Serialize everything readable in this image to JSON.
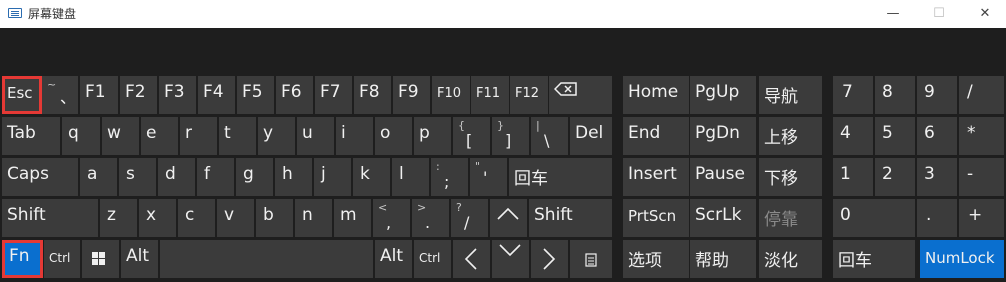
{
  "window": {
    "title": "屏幕键盘",
    "minimize": "—",
    "maximize": "☐",
    "close": "✕"
  },
  "keys": {
    "esc": "Esc",
    "tilde": "~",
    "backtick": "、",
    "f1": "F1",
    "f2": "F2",
    "f3": "F3",
    "f4": "F4",
    "f5": "F5",
    "f6": "F6",
    "f7": "F7",
    "f8": "F8",
    "f9": "F9",
    "f10": "F10",
    "f11": "F11",
    "f12": "F12",
    "home": "Home",
    "pgup": "PgUp",
    "nav": "导航",
    "tab": "Tab",
    "q": "q",
    "w": "w",
    "e": "e",
    "r": "r",
    "t": "t",
    "y": "y",
    "u": "u",
    "i": "i",
    "o": "o",
    "p": "p",
    "lbrace": "{",
    "lbracket": "[",
    "rbrace": "}",
    "rbracket": "]",
    "pipe": "|",
    "backslash": "\\",
    "del": "Del",
    "end": "End",
    "pgdn": "PgDn",
    "moveup": "上移",
    "caps": "Caps",
    "a": "a",
    "s": "s",
    "d": "d",
    "f": "f",
    "g": "g",
    "h": "h",
    "j": "j",
    "k": "k",
    "l": "l",
    "colon": ":",
    "semicolon": ";",
    "quote": "\"",
    "apostrophe": "'",
    "enter": "回车",
    "insert": "Insert",
    "pause": "Pause",
    "movedown": "下移",
    "shift": "Shift",
    "z": "z",
    "x": "x",
    "c": "c",
    "v": "v",
    "b": "b",
    "n": "n",
    "m": "m",
    "lt": "<",
    "comma": ",",
    "gt": ">",
    "period": ".",
    "question": "?",
    "slash": "/",
    "prtscn": "PrtScn",
    "scrlk": "ScrLk",
    "dock": "停靠",
    "fn": "Fn",
    "ctrl": "Ctrl",
    "alt": "Alt",
    "options": "选项",
    "help": "帮助",
    "fade": "淡化",
    "num7": "7",
    "num8": "8",
    "num9": "9",
    "numdiv": "/",
    "num4": "4",
    "num5": "5",
    "num6": "6",
    "nummul": "*",
    "num1": "1",
    "num2": "2",
    "num3": "3",
    "numsub": "-",
    "num0": "0",
    "numdot": ".",
    "numadd": "+",
    "numenter": "回车",
    "numlock": "NumLock"
  },
  "highlighted_keys": [
    "Esc",
    "Fn"
  ],
  "active_keys": [
    "Fn",
    "NumLock"
  ],
  "colors": {
    "background": "#1e1e1e",
    "key": "#3b3b3b",
    "active": "#0a6fcf",
    "highlight": "#e53935",
    "titlebar": "#ffffff"
  },
  "icons": {
    "backspace": "backspace-icon",
    "windows": "windows-logo-icon",
    "menu": "context-menu-icon",
    "arrows": [
      "left-arrow-icon",
      "right-arrow-icon",
      "up-arrow-icon",
      "down-arrow-icon"
    ]
  }
}
